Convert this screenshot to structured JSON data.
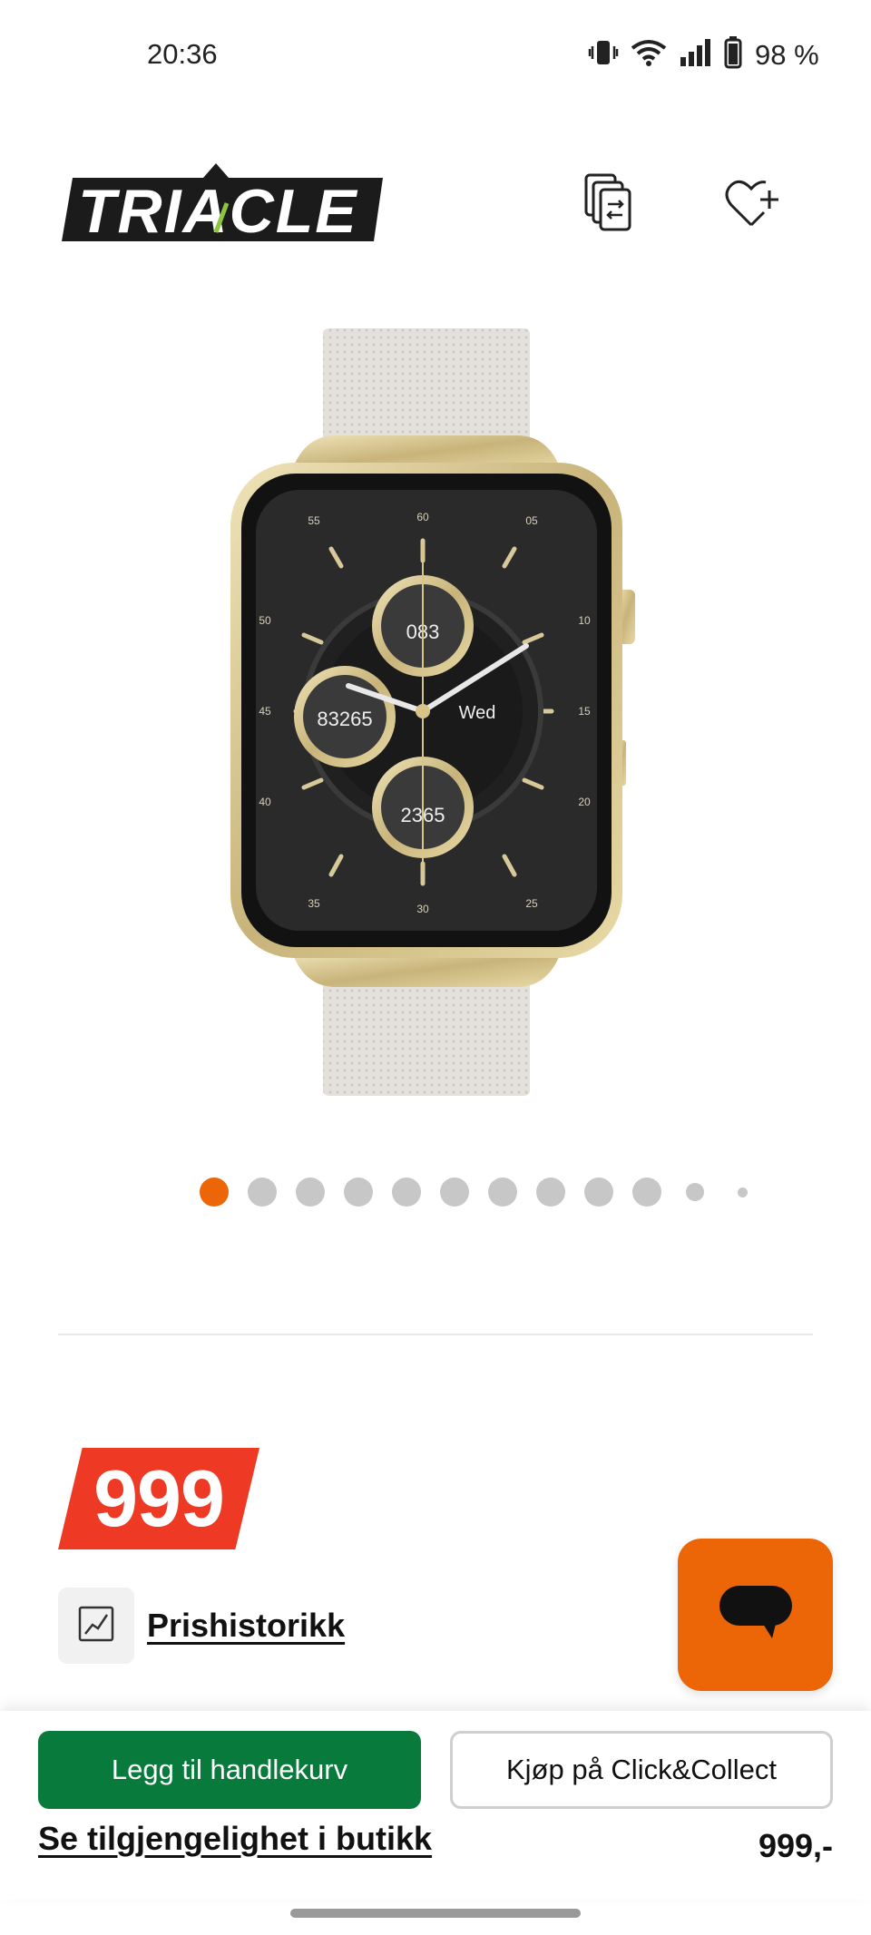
{
  "status_bar": {
    "time": "20:36",
    "battery": "98 %",
    "icons": [
      "vibrate-icon",
      "wifi-icon",
      "signal-icon",
      "battery-icon"
    ]
  },
  "header": {
    "logo_text": "TRIACLE",
    "compare_icon": "compare-icon",
    "wishlist_icon": "heart-plus-icon"
  },
  "product_image": {
    "watch_face": {
      "top_dial": "083",
      "left_dial": "83265",
      "bottom_dial": "2365",
      "day": "Wed",
      "bezel_numbers": [
        "60",
        "05",
        "10",
        "15",
        "20",
        "25",
        "30",
        "35",
        "40",
        "45",
        "50",
        "55"
      ]
    }
  },
  "carousel": {
    "total": 12,
    "active_index": 0
  },
  "price": {
    "badge": "999",
    "history_label": "Prishistorikk"
  },
  "chat": {
    "icon": "chat-icon"
  },
  "bottom_bar": {
    "add_to_cart": "Legg til handlekurv",
    "click_collect": "Kjøp på Click&Collect",
    "store_availability": "Se tilgjengelighet i butikk",
    "price": "999,-"
  },
  "colors": {
    "accent": "#ec6608",
    "price_badge": "#ee3a24",
    "cart_button": "#087a3c"
  }
}
